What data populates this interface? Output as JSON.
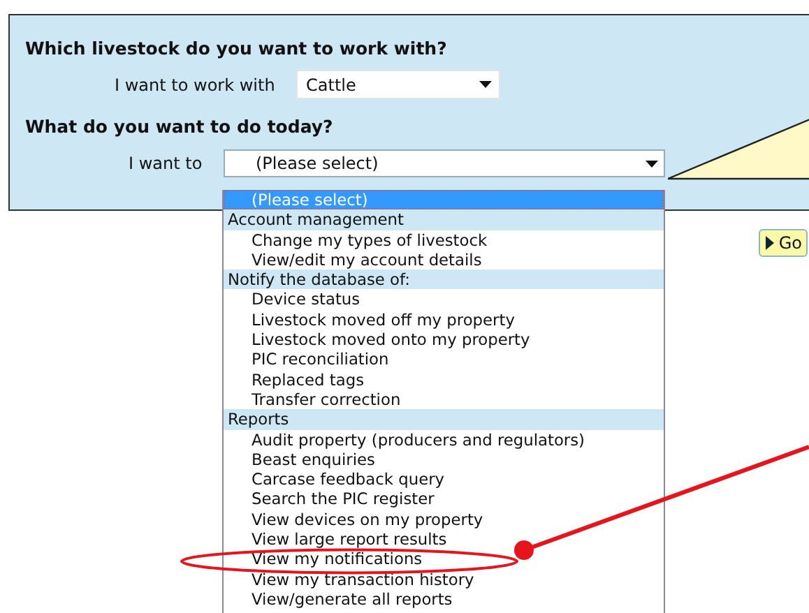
{
  "livestock": {
    "heading": "Which livestock do you want to work with?",
    "label": "I want to work with",
    "value": "Cattle"
  },
  "task": {
    "heading": "What do you want to do today?",
    "label": "I want to",
    "value": "(Please select)"
  },
  "dropdown": [
    {
      "kind": "option",
      "label": "(Please select)",
      "selected": true
    },
    {
      "kind": "group",
      "label": "Account management"
    },
    {
      "kind": "option",
      "label": "Change my types of livestock",
      "selected": false
    },
    {
      "kind": "option",
      "label": "View/edit my account details",
      "selected": false
    },
    {
      "kind": "group",
      "label": "Notify the database of:"
    },
    {
      "kind": "option",
      "label": "Device status",
      "selected": false
    },
    {
      "kind": "option",
      "label": "Livestock moved off my property",
      "selected": false
    },
    {
      "kind": "option",
      "label": "Livestock moved onto my property",
      "selected": false
    },
    {
      "kind": "option",
      "label": "PIC reconciliation",
      "selected": false
    },
    {
      "kind": "option",
      "label": "Replaced tags",
      "selected": false
    },
    {
      "kind": "option",
      "label": "Transfer correction",
      "selected": false
    },
    {
      "kind": "group",
      "label": "Reports"
    },
    {
      "kind": "option",
      "label": "Audit property (producers and regulators)",
      "selected": false
    },
    {
      "kind": "option",
      "label": "Beast enquiries",
      "selected": false
    },
    {
      "kind": "option",
      "label": "Carcase feedback query",
      "selected": false
    },
    {
      "kind": "option",
      "label": "Search the PIC register",
      "selected": false
    },
    {
      "kind": "option",
      "label": "View devices on my property",
      "selected": false
    },
    {
      "kind": "option",
      "label": "View large report results",
      "selected": false
    },
    {
      "kind": "option",
      "label": "View my notifications",
      "selected": false
    },
    {
      "kind": "option",
      "label": "View my transaction history",
      "selected": false
    },
    {
      "kind": "option",
      "label": "View/generate all reports",
      "selected": false
    }
  ],
  "go_button": "Go"
}
